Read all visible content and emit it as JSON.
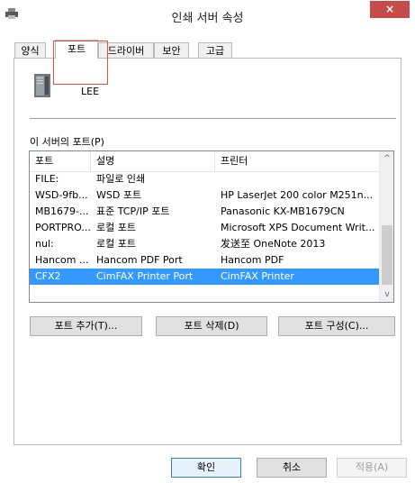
{
  "window": {
    "title": "인쇄 서버 속성",
    "close_glyph": "×"
  },
  "tabs": [
    {
      "label": "양식"
    },
    {
      "label": "포트",
      "active": true
    },
    {
      "label": "드라이버"
    },
    {
      "label": "보안"
    },
    {
      "label": "고급"
    }
  ],
  "server": {
    "name": "LEE",
    "icon": "server-tower-icon"
  },
  "ports": {
    "section_label": "이 서버의 포트(P)",
    "columns": [
      "포트",
      "설명",
      "프린터"
    ],
    "rows": [
      {
        "port": "FILE:",
        "description": "파일로 인쇄",
        "printer": ""
      },
      {
        "port": "WSD-9fb...",
        "description": "WSD 포트",
        "printer": "HP LaserJet 200 color M251n..."
      },
      {
        "port": "MB1679-...",
        "description": "표준 TCP/IP 포트",
        "printer": "Panasonic KX-MB1679CN"
      },
      {
        "port": "PORTPRO...",
        "description": "로컬 포트",
        "printer": "Microsoft XPS Document Writ..."
      },
      {
        "port": "nul:",
        "description": "로컬 포트",
        "printer": "发送至 OneNote 2013"
      },
      {
        "port": "Hancom ...",
        "description": "Hancom PDF Port",
        "printer": "Hancom PDF"
      },
      {
        "port": "CFX2",
        "description": "CimFAX Printer Port",
        "printer": "CimFAX Printer",
        "selected": true
      }
    ],
    "scroll_up_glyph": "^",
    "scroll_down_glyph": "v"
  },
  "port_buttons": {
    "add": "포트 추가(T)...",
    "delete": "포트 삭제(D)",
    "configure": "포트 구성(C)..."
  },
  "dialog_buttons": {
    "ok": "확인",
    "cancel": "취소",
    "apply": "적용(A)"
  },
  "colors": {
    "close": "#c74b49",
    "selection": "#3399ff",
    "highlight": "#e15244"
  }
}
